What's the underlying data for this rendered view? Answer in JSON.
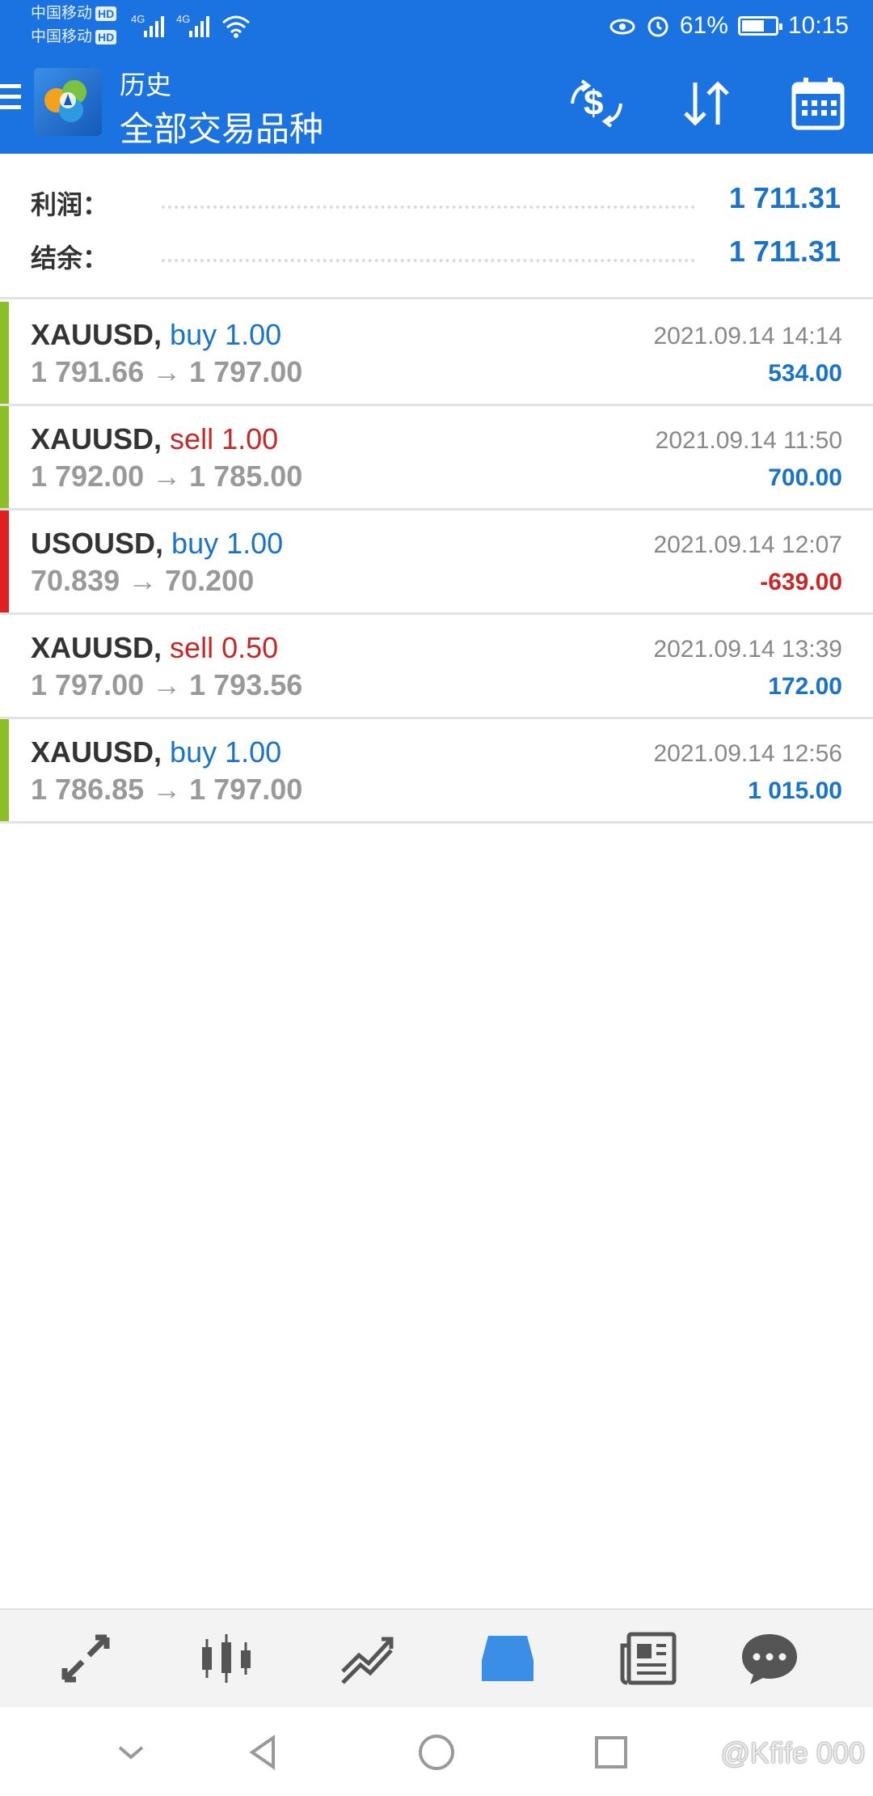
{
  "status_bar": {
    "carrier1": "中国移动",
    "carrier2": "中国移动",
    "hd": "HD",
    "network": "4G",
    "battery_text": "61%",
    "battery_level": 0.61,
    "time": "10:15"
  },
  "toolbar": {
    "subtitle": "历史",
    "title": "全部交易品种"
  },
  "summary": {
    "profit_label": "利润：",
    "profit_value": "1 711.31",
    "balance_label": "结余：",
    "balance_value": "1 711.31"
  },
  "trades": [
    {
      "symbol": "XAUUSD,",
      "side": "buy 1.00",
      "side_type": "buy",
      "prices": "1 791.66 → 1 797.00",
      "time": "2021.09.14 14:14",
      "profit": "534.00",
      "bar_color": "#8cbf26"
    },
    {
      "symbol": "XAUUSD,",
      "side": "sell 1.00",
      "side_type": "sell",
      "prices": "1 792.00 → 1 785.00",
      "time": "2021.09.14 11:50",
      "profit": "700.00",
      "bar_color": "#8cbf26"
    },
    {
      "symbol": "USOUSD,",
      "side": "buy 1.00",
      "side_type": "buy",
      "prices": "70.839 → 70.200",
      "time": "2021.09.14 12:07",
      "profit": "-639.00",
      "bar_color": "#e02020"
    },
    {
      "symbol": "XAUUSD,",
      "side": "sell 0.50",
      "side_type": "sell",
      "prices": "1 797.00 → 1 793.56",
      "time": "2021.09.14 13:39",
      "profit": "172.00",
      "bar_color": ""
    },
    {
      "symbol": "XAUUSD,",
      "side": "buy 1.00",
      "side_type": "buy",
      "prices": "1 786.85 → 1 797.00",
      "time": "2021.09.14 12:56",
      "profit": "1 015.00",
      "bar_color": "#8cbf26"
    }
  ],
  "colors": {
    "header_bg": "#1a73e0",
    "buy": "#1a73c8",
    "sell": "#c62828",
    "profit_positive": "#1a73c8",
    "profit_negative": "#c62828",
    "nav_active": "#3a8ee6",
    "nav_inactive": "#555555"
  },
  "bottom_nav": [
    {
      "name": "quotes",
      "icon": "quotes-arrows-icon",
      "active": false
    },
    {
      "name": "chart",
      "icon": "candlestick-icon",
      "active": false
    },
    {
      "name": "trade",
      "icon": "trade-lines-icon",
      "active": false
    },
    {
      "name": "history",
      "icon": "inbox-tray-icon",
      "active": true
    },
    {
      "name": "news",
      "icon": "newspaper-icon",
      "active": false
    },
    {
      "name": "messages",
      "icon": "chat-bubble-icon",
      "active": false
    }
  ],
  "watermark": "@Kfife 000"
}
